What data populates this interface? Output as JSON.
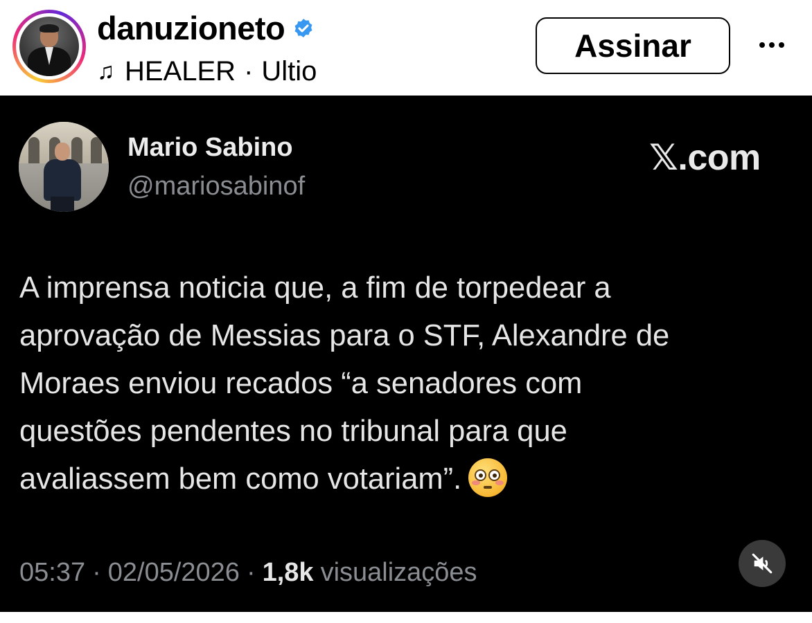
{
  "post_header": {
    "username": "danuzioneto",
    "verified_icon": "verified-badge-icon",
    "music_icon": "music-note-icon",
    "music_track": "HEALER",
    "music_separator": "·",
    "music_artist": "Ultio",
    "subscribe_label": "Assinar",
    "more_icon": "more-options-icon",
    "colors": {
      "verified": "#3897f0",
      "ring_start": "#f9ce34",
      "ring_mid": "#ee2a7b",
      "ring_end": "#6228d7"
    }
  },
  "tweet": {
    "author_name": "Mario Sabino",
    "author_handle": "@mariosabinof",
    "brand": "𝕏.com",
    "text": "A imprensa noticia que, a fim de torpedear a\naprovação de Messias para o STF,  Alexandre de\nMoraes enviou recados “a senadores com\nquestões pendentes no tribunal para que\navaliassem bem como votariam”.",
    "emoji": "flushed-face-emoji",
    "time": "05:37",
    "date": "02/05/2026",
    "separator": "·",
    "views_count": "1,8k",
    "views_label": "visualizações",
    "mute_icon": "speaker-muted-icon"
  }
}
